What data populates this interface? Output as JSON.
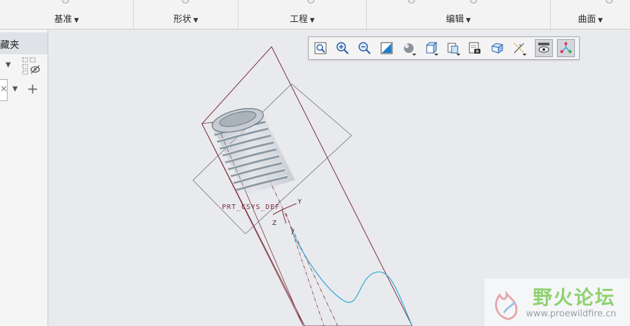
{
  "ribbon": {
    "groups": [
      {
        "label": "基准"
      },
      {
        "label": "形状"
      },
      {
        "label": "工程"
      },
      {
        "label": "编辑"
      },
      {
        "label": "曲面"
      }
    ]
  },
  "left_panel": {
    "tab_label": "藏夹"
  },
  "viewport": {
    "csys_label": "PRT_CSYS_DEF",
    "axis_y": "Y",
    "axis_z": "Z",
    "axis_y_small": "y"
  },
  "toolbar": {
    "buttons": [
      {
        "name": "refit-icon"
      },
      {
        "name": "zoom-in-icon"
      },
      {
        "name": "zoom-out-icon"
      },
      {
        "name": "repaint-icon"
      },
      {
        "name": "display-style-icon"
      },
      {
        "name": "saved-orientations-icon"
      },
      {
        "name": "saved-views-icon"
      },
      {
        "name": "view-manager-icon"
      },
      {
        "name": "perspective-view-icon"
      },
      {
        "name": "datum-display-icon"
      },
      {
        "name": "spin-center-icon"
      },
      {
        "name": "annotation-display-icon"
      }
    ]
  },
  "watermark": {
    "title": "野火论坛",
    "url": "www.proewildfire.cn"
  },
  "colors": {
    "curve": "#2aa7d9",
    "plane": "#7a2e3a",
    "thread": "#9aa6b2"
  }
}
